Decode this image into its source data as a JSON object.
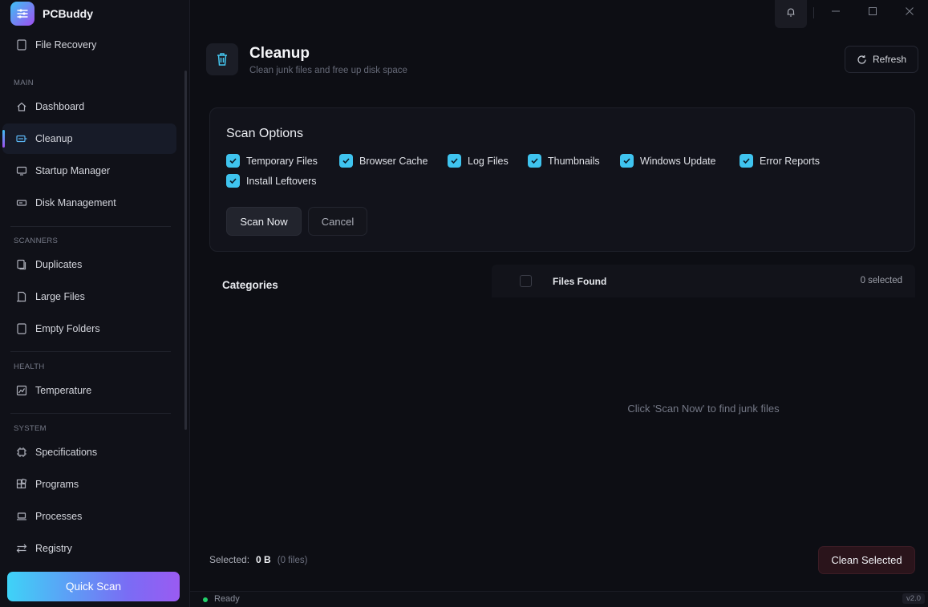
{
  "app": {
    "name": "PCBuddy"
  },
  "sidebar": {
    "top_item": {
      "label": "File Recovery"
    },
    "sections": {
      "main": "MAIN",
      "scanners": "SCANNERS",
      "health": "HEALTH",
      "system": "SYSTEM"
    },
    "items": [
      {
        "label": "Dashboard",
        "icon": "home-icon"
      },
      {
        "label": "Cleanup",
        "icon": "cleanup-icon",
        "active": true
      },
      {
        "label": "Startup Manager",
        "icon": "monitor-icon"
      },
      {
        "label": "Disk Management",
        "icon": "disk-icon"
      },
      {
        "label": "Duplicates",
        "icon": "duplicate-icon"
      },
      {
        "label": "Large Files",
        "icon": "large-file-icon"
      },
      {
        "label": "Empty Folders",
        "icon": "folder-icon"
      },
      {
        "label": "Temperature",
        "icon": "chart-icon"
      },
      {
        "label": "Specifications",
        "icon": "chip-icon"
      },
      {
        "label": "Programs",
        "icon": "apps-icon"
      },
      {
        "label": "Processes",
        "icon": "laptop-icon"
      },
      {
        "label": "Registry",
        "icon": "swap-icon"
      }
    ],
    "quick_scan": "Quick Scan"
  },
  "header": {
    "title": "Cleanup",
    "subtitle": "Clean junk files and free up disk space",
    "refresh": "Refresh"
  },
  "scan_options": {
    "title": "Scan Options",
    "options": [
      {
        "label": "Temporary Files",
        "checked": true
      },
      {
        "label": "Browser Cache",
        "checked": true
      },
      {
        "label": "Log Files",
        "checked": true
      },
      {
        "label": "Thumbnails",
        "checked": true
      },
      {
        "label": "Windows Update",
        "checked": true
      },
      {
        "label": "Error Reports",
        "checked": true
      },
      {
        "label": "Install Leftovers",
        "checked": true
      }
    ],
    "scan_button": "Scan Now",
    "cancel_button": "Cancel"
  },
  "categories": {
    "title": "Categories"
  },
  "files": {
    "title": "Files Found",
    "selected_count": "0 selected",
    "empty_message": "Click 'Scan Now' to find junk files"
  },
  "footer": {
    "selected_label": "Selected:",
    "selected_size": "0 B",
    "selected_files": "(0 files)",
    "clean_button": "Clean Selected"
  },
  "status": {
    "text": "Ready",
    "version": "v2.0"
  },
  "colors": {
    "accent": "#3fc4ef",
    "accent2": "#a04ff0",
    "status_ok": "#22d06a"
  }
}
